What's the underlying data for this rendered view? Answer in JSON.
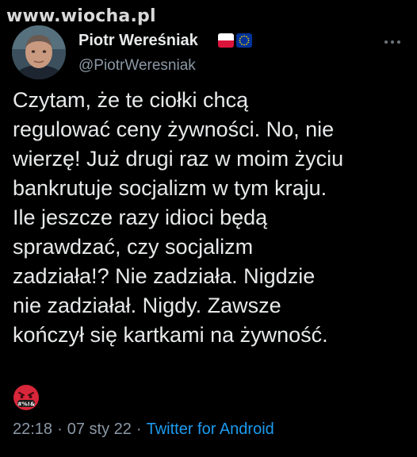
{
  "watermark": "www.wiocha.pl",
  "author": {
    "display_name": "Piotr Wereśniak",
    "handle": "@PiotrWeresniak",
    "flags": [
      "poland-flag",
      "eu-flag"
    ]
  },
  "tweet": {
    "lines": [
      "Czytam, że te ciołki chcą",
      "regulować ceny żywności. No, nie",
      "wierzę! Już drugi raz w moim życiu",
      "bankrutuje socjalizm w tym kraju.",
      "Ile jeszcze razy idioci będą",
      "sprawdzać, czy socjalizm",
      "zadziała!? Nie zadziała. Nigdzie",
      "nie zadziałał. Nigdy. Zawsze",
      "kończył się kartkami na żywność."
    ],
    "emoji_label": "#%!&",
    "emoji_icon": "face-with-symbols-on-mouth-icon"
  },
  "meta": {
    "time": "22:18",
    "separator": "·",
    "date": "07 sty 22",
    "source": "Twitter for Android"
  },
  "colors": {
    "background": "#000000",
    "text": "#e7e9ea",
    "secondary": "#8b98a5",
    "link": "#1d9bf0",
    "emoji_red": "#d8263a"
  }
}
